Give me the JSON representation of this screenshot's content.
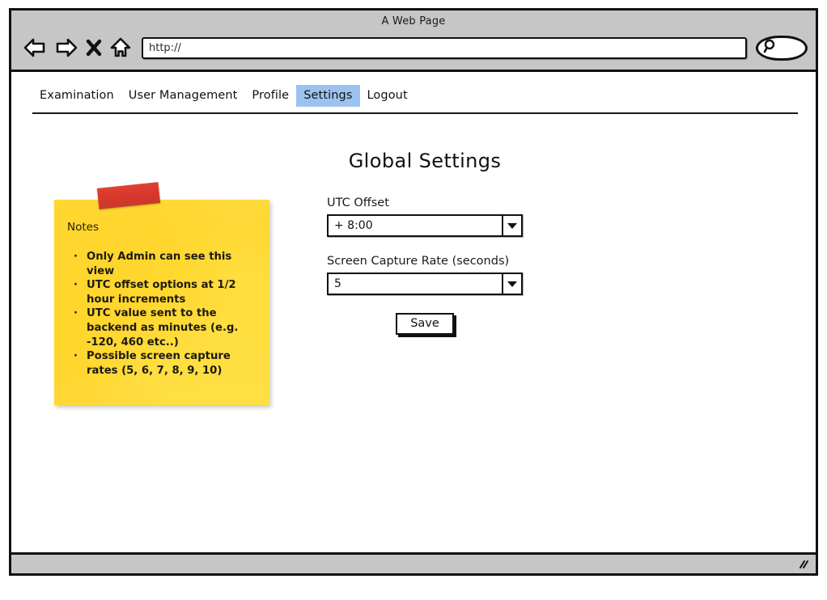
{
  "browser": {
    "window_title": "A Web Page",
    "url_value": "http://",
    "url_placeholder": "http://",
    "icons": {
      "back": "back-arrow-icon",
      "forward": "forward-arrow-icon",
      "stop": "close-x-icon",
      "home": "home-icon",
      "search": "search-icon",
      "resize": "resize-grip-icon"
    }
  },
  "navbar": {
    "items": [
      {
        "label": "Examination",
        "active": false
      },
      {
        "label": "User Management",
        "active": false
      },
      {
        "label": "Profile",
        "active": false
      },
      {
        "label": "Settings",
        "active": true
      },
      {
        "label": "Logout",
        "active": false
      }
    ],
    "active_color": "#9cc3f0"
  },
  "main": {
    "title": "Global Settings",
    "fields": [
      {
        "label": "UTC Offset",
        "value": "+ 8:00"
      },
      {
        "label": "Screen Capture Rate (seconds)",
        "value": "5"
      }
    ],
    "save_label": "Save"
  },
  "note": {
    "title": "Notes",
    "background_color": "#ffd93b",
    "tape_color": "#d6372a",
    "lines": [
      {
        "bullet": true,
        "text": "Only Admin can see this view"
      },
      {
        "bullet": true,
        "text": "UTC offset options at 1/2"
      },
      {
        "bullet": false,
        "text": "hour increments"
      },
      {
        "bullet": true,
        "text": "UTC value sent to the"
      },
      {
        "bullet": false,
        "text": "backend as minutes (e.g."
      },
      {
        "bullet": false,
        "text": "-120, 460 etc..)"
      },
      {
        "bullet": true,
        "text": "Possible screen capture"
      },
      {
        "bullet": false,
        "text": "rates (5, 6, 7, 8, 9, 10)"
      }
    ],
    "bullet_glyph": "·"
  }
}
